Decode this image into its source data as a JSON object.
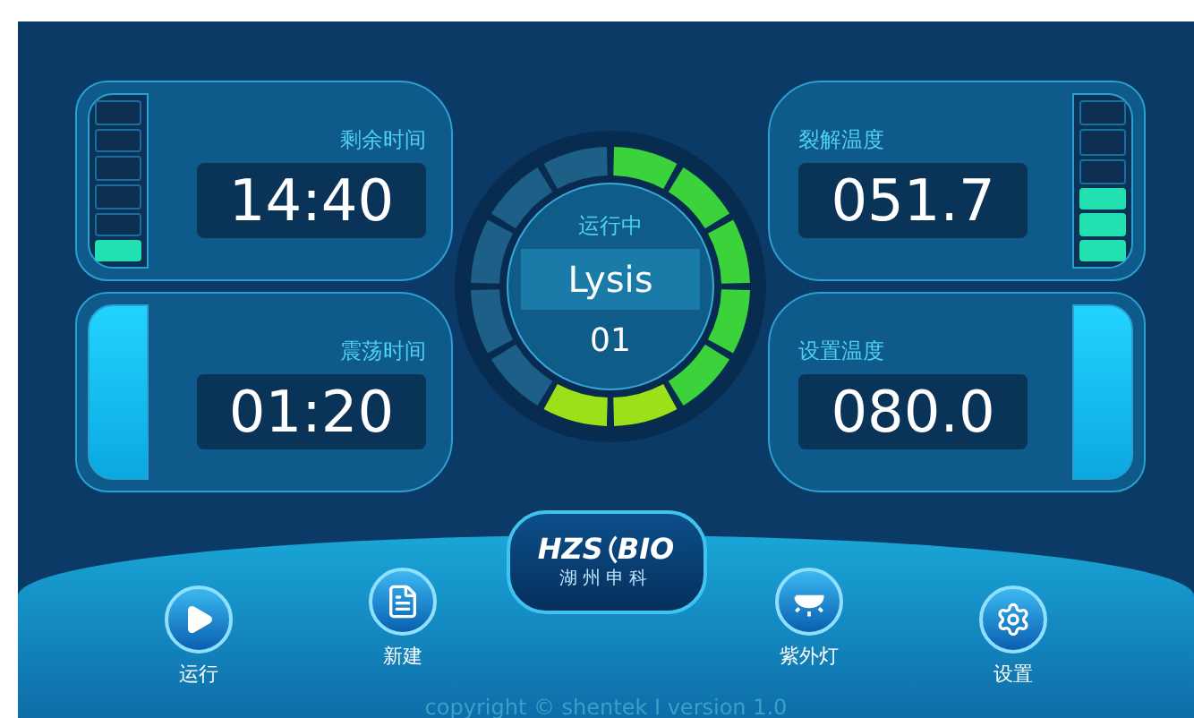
{
  "left_panels": [
    {
      "kind": "segments",
      "label": "剩余时间",
      "value": "14:40",
      "level": 0.17
    },
    {
      "kind": "bar",
      "label": "震荡时间",
      "value": "01:20"
    }
  ],
  "center": {
    "status": "运行中",
    "step": "Lysis",
    "number": "01",
    "level": 0.58
  },
  "right_panels": [
    {
      "kind": "segments",
      "label": "裂解温度",
      "value": "051.7",
      "level": 0.5
    },
    {
      "kind": "bar",
      "label": "设置温度",
      "value": "080.0"
    }
  ],
  "nav_left": [
    {
      "label": "运行"
    },
    {
      "label": "新建"
    }
  ],
  "logo": {
    "name": "HZS",
    "suffix": "BIO",
    "subtitle": "湖州申科"
  },
  "nav_right": [
    {
      "label": "紫外灯"
    },
    {
      "label": "设置"
    }
  ],
  "footer": "copyright © shentek I version 1.0"
}
